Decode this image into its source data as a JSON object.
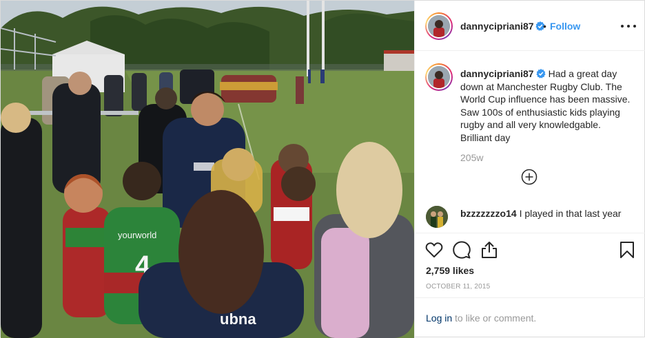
{
  "post": {
    "username": "dannycipriani87",
    "follow_dot": "•",
    "follow_label": "Follow",
    "more_icon": "more-horizontal-icon",
    "accent_color": "#3897f0",
    "verified_color": "#3897f0"
  },
  "caption": {
    "username": "dannycipriani87",
    "text": "Had a great day down at Manchester Rugby Club. The World Cup influence has been massive. Saw 100s of enthusiastic kids playing rugby and all very knowledgable. Brilliant day",
    "time": "205w"
  },
  "comments": [
    {
      "username": "bzzzzzzzo14",
      "text": "I played in that last year"
    }
  ],
  "actions": {
    "like_icon": "heart-icon",
    "comment_icon": "comment-icon",
    "share_icon": "share-icon",
    "save_icon": "bookmark-icon",
    "likes": "2,759 likes",
    "date": "October 11, 2015"
  },
  "login": {
    "link": "Log in",
    "rest": " to like or comment."
  }
}
